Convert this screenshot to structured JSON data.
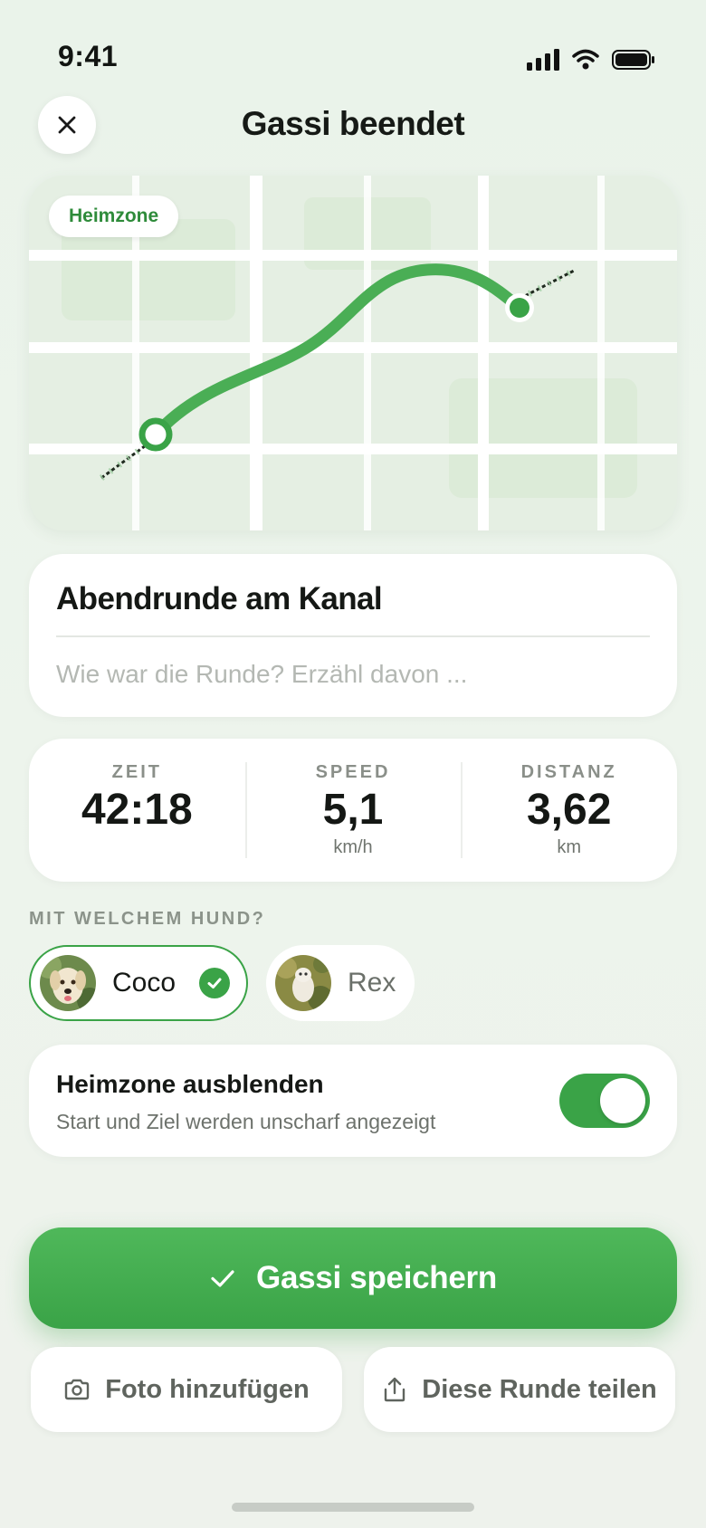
{
  "status_bar": {
    "time": "9:41"
  },
  "header": {
    "title": "Gassi beendet"
  },
  "map": {
    "badge": "Heimzone",
    "route_color": "#3aa347"
  },
  "walk": {
    "title": "Abendrunde am Kanal",
    "notes_placeholder": "Wie war die Runde? Erzähl davon ...",
    "notes_value": ""
  },
  "stats": [
    {
      "label": "ZEIT",
      "value": "42:18",
      "unit": ""
    },
    {
      "label": "SPEED",
      "value": "5,1",
      "unit": "km/h"
    },
    {
      "label": "DISTANZ",
      "value": "3,62",
      "unit": "km"
    }
  ],
  "dogs": {
    "section_label": "MIT WELCHEM HUND?",
    "items": [
      {
        "name": "Coco",
        "selected": true
      },
      {
        "name": "Rex",
        "selected": false
      }
    ]
  },
  "privacy": {
    "title": "Heimzone ausblenden",
    "subtitle": "Start und Ziel werden unscharf angezeigt",
    "enabled": true
  },
  "actions": {
    "save_label": "Gassi speichern",
    "photo_label": "Foto hinzufügen",
    "share_label": "Diese Runde teilen"
  },
  "colors": {
    "accent": "#3aa347",
    "background": "#ecf3eb"
  }
}
